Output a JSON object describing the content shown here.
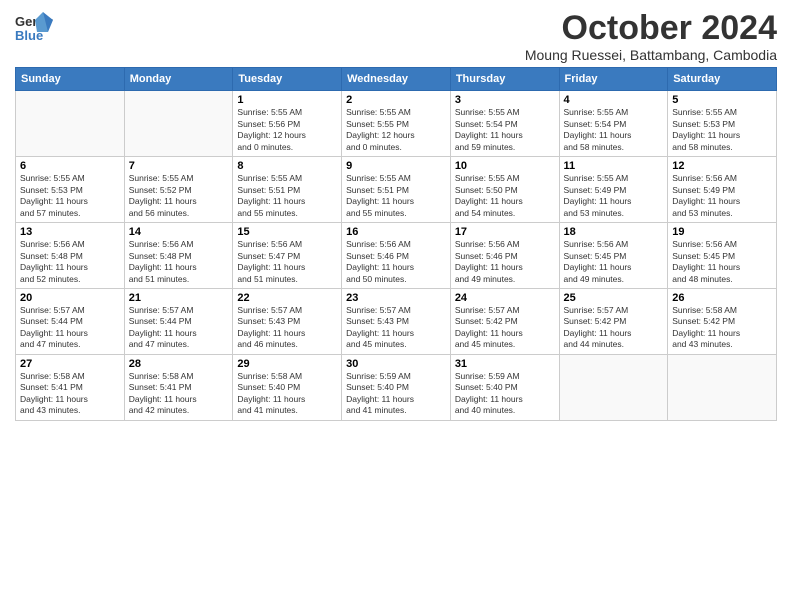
{
  "header": {
    "logo_general": "General",
    "logo_blue": "Blue",
    "month_title": "October 2024",
    "location": "Moung Ruessei, Battambang, Cambodia"
  },
  "weekdays": [
    "Sunday",
    "Monday",
    "Tuesday",
    "Wednesday",
    "Thursday",
    "Friday",
    "Saturday"
  ],
  "weeks": [
    [
      {
        "day": "",
        "info": ""
      },
      {
        "day": "",
        "info": ""
      },
      {
        "day": "1",
        "info": "Sunrise: 5:55 AM\nSunset: 5:56 PM\nDaylight: 12 hours\nand 0 minutes."
      },
      {
        "day": "2",
        "info": "Sunrise: 5:55 AM\nSunset: 5:55 PM\nDaylight: 12 hours\nand 0 minutes."
      },
      {
        "day": "3",
        "info": "Sunrise: 5:55 AM\nSunset: 5:54 PM\nDaylight: 11 hours\nand 59 minutes."
      },
      {
        "day": "4",
        "info": "Sunrise: 5:55 AM\nSunset: 5:54 PM\nDaylight: 11 hours\nand 58 minutes."
      },
      {
        "day": "5",
        "info": "Sunrise: 5:55 AM\nSunset: 5:53 PM\nDaylight: 11 hours\nand 58 minutes."
      }
    ],
    [
      {
        "day": "6",
        "info": "Sunrise: 5:55 AM\nSunset: 5:53 PM\nDaylight: 11 hours\nand 57 minutes."
      },
      {
        "day": "7",
        "info": "Sunrise: 5:55 AM\nSunset: 5:52 PM\nDaylight: 11 hours\nand 56 minutes."
      },
      {
        "day": "8",
        "info": "Sunrise: 5:55 AM\nSunset: 5:51 PM\nDaylight: 11 hours\nand 55 minutes."
      },
      {
        "day": "9",
        "info": "Sunrise: 5:55 AM\nSunset: 5:51 PM\nDaylight: 11 hours\nand 55 minutes."
      },
      {
        "day": "10",
        "info": "Sunrise: 5:55 AM\nSunset: 5:50 PM\nDaylight: 11 hours\nand 54 minutes."
      },
      {
        "day": "11",
        "info": "Sunrise: 5:55 AM\nSunset: 5:49 PM\nDaylight: 11 hours\nand 53 minutes."
      },
      {
        "day": "12",
        "info": "Sunrise: 5:56 AM\nSunset: 5:49 PM\nDaylight: 11 hours\nand 53 minutes."
      }
    ],
    [
      {
        "day": "13",
        "info": "Sunrise: 5:56 AM\nSunset: 5:48 PM\nDaylight: 11 hours\nand 52 minutes."
      },
      {
        "day": "14",
        "info": "Sunrise: 5:56 AM\nSunset: 5:48 PM\nDaylight: 11 hours\nand 51 minutes."
      },
      {
        "day": "15",
        "info": "Sunrise: 5:56 AM\nSunset: 5:47 PM\nDaylight: 11 hours\nand 51 minutes."
      },
      {
        "day": "16",
        "info": "Sunrise: 5:56 AM\nSunset: 5:46 PM\nDaylight: 11 hours\nand 50 minutes."
      },
      {
        "day": "17",
        "info": "Sunrise: 5:56 AM\nSunset: 5:46 PM\nDaylight: 11 hours\nand 49 minutes."
      },
      {
        "day": "18",
        "info": "Sunrise: 5:56 AM\nSunset: 5:45 PM\nDaylight: 11 hours\nand 49 minutes."
      },
      {
        "day": "19",
        "info": "Sunrise: 5:56 AM\nSunset: 5:45 PM\nDaylight: 11 hours\nand 48 minutes."
      }
    ],
    [
      {
        "day": "20",
        "info": "Sunrise: 5:57 AM\nSunset: 5:44 PM\nDaylight: 11 hours\nand 47 minutes."
      },
      {
        "day": "21",
        "info": "Sunrise: 5:57 AM\nSunset: 5:44 PM\nDaylight: 11 hours\nand 47 minutes."
      },
      {
        "day": "22",
        "info": "Sunrise: 5:57 AM\nSunset: 5:43 PM\nDaylight: 11 hours\nand 46 minutes."
      },
      {
        "day": "23",
        "info": "Sunrise: 5:57 AM\nSunset: 5:43 PM\nDaylight: 11 hours\nand 45 minutes."
      },
      {
        "day": "24",
        "info": "Sunrise: 5:57 AM\nSunset: 5:42 PM\nDaylight: 11 hours\nand 45 minutes."
      },
      {
        "day": "25",
        "info": "Sunrise: 5:57 AM\nSunset: 5:42 PM\nDaylight: 11 hours\nand 44 minutes."
      },
      {
        "day": "26",
        "info": "Sunrise: 5:58 AM\nSunset: 5:42 PM\nDaylight: 11 hours\nand 43 minutes."
      }
    ],
    [
      {
        "day": "27",
        "info": "Sunrise: 5:58 AM\nSunset: 5:41 PM\nDaylight: 11 hours\nand 43 minutes."
      },
      {
        "day": "28",
        "info": "Sunrise: 5:58 AM\nSunset: 5:41 PM\nDaylight: 11 hours\nand 42 minutes."
      },
      {
        "day": "29",
        "info": "Sunrise: 5:58 AM\nSunset: 5:40 PM\nDaylight: 11 hours\nand 41 minutes."
      },
      {
        "day": "30",
        "info": "Sunrise: 5:59 AM\nSunset: 5:40 PM\nDaylight: 11 hours\nand 41 minutes."
      },
      {
        "day": "31",
        "info": "Sunrise: 5:59 AM\nSunset: 5:40 PM\nDaylight: 11 hours\nand 40 minutes."
      },
      {
        "day": "",
        "info": ""
      },
      {
        "day": "",
        "info": ""
      }
    ]
  ]
}
